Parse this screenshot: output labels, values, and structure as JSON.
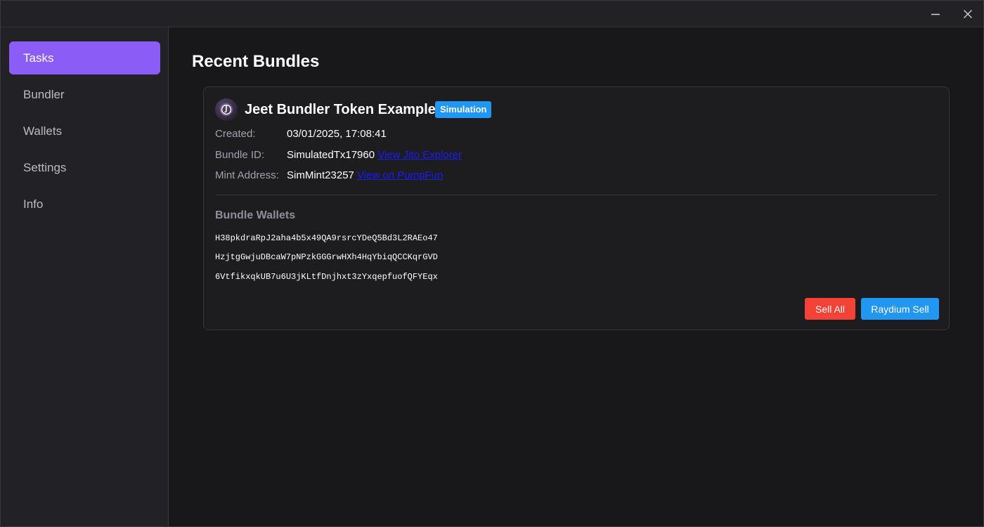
{
  "window": {
    "minimize_icon": "minimize-icon",
    "close_icon": "close-icon"
  },
  "sidebar": {
    "items": [
      {
        "label": "Tasks",
        "active": true
      },
      {
        "label": "Bundler",
        "active": false
      },
      {
        "label": "Wallets",
        "active": false
      },
      {
        "label": "Settings",
        "active": false
      },
      {
        "label": "Info",
        "active": false
      }
    ]
  },
  "main": {
    "title": "Recent Bundles",
    "bundle": {
      "icon": "token-logo-icon",
      "name": "Jeet Bundler Token Example",
      "badge": "Simulation",
      "created_label": "Created:",
      "created_value": "03/01/2025, 17:08:41",
      "bundle_id_label": "Bundle ID:",
      "bundle_id_value": "SimulatedTx17960",
      "bundle_id_link": "View Jito Explorer",
      "mint_label": "Mint Address:",
      "mint_value": "SimMint23257",
      "mint_link": "View on PumpFun",
      "wallets_title": "Bundle Wallets",
      "wallets": [
        "H38pkdraRpJ2aha4b5x49QA9rsrcYDeQ5Bd3L2RAEo47",
        "HzjtgGwjuDBcaW7pNPzkGGGrwHXh4HqYbiqQCCKqrGVD",
        "6VtfikxqkUB7u6U3jKLtfDnjhxt3zYxqepfuofQFYEqx"
      ],
      "sell_all_label": "Sell All",
      "raydium_sell_label": "Raydium Sell"
    }
  },
  "colors": {
    "accent": "#8b5cf6",
    "badge": "#2196f3",
    "sell": "#f44336",
    "raydium": "#2196f3",
    "link": "#1a1aff"
  }
}
